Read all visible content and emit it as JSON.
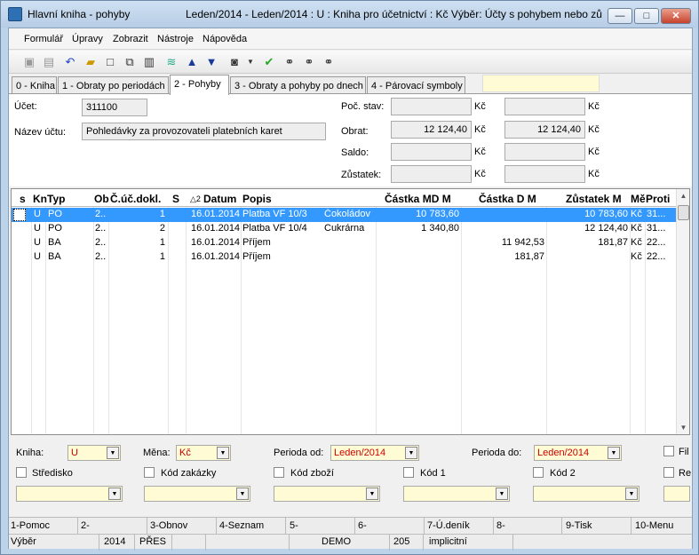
{
  "window": {
    "title_left": "Hlavní kniha - pohyby",
    "title_right": "Leden/2014 - Leden/2014 : U : Kniha pro účetnictví : Kč Výběr: Účty s pohybem nebo zů...",
    "min": "—",
    "max": "□",
    "close": "✕"
  },
  "menu": [
    "Formulář",
    "Úpravy",
    "Zobrazit",
    "Nástroje",
    "Nápověda"
  ],
  "tabs": [
    "0 - Kniha",
    "1 - Obraty po periodách",
    "2 - Pohyby",
    "3 - Obraty a pohyby po dnech",
    "4 - Párovací symboly"
  ],
  "header": {
    "ucet_label": "Účet:",
    "ucet_value": "311100",
    "nazev_label": "Název účtu:",
    "nazev_value": "Pohledávky za provozovateli platebních karet",
    "poc_stav_label": "Poč. stav:",
    "obrat_label": "Obrat:",
    "saldo_label": "Saldo:",
    "zustatek_label": "Zůstatek:",
    "obrat_value1": "12 124,40",
    "obrat_value2": "12 124,40",
    "currency": "Kč"
  },
  "grid": {
    "columns": [
      "s",
      "Kn",
      "Typ",
      "Ob",
      "Č.úč.dokl.",
      "S",
      "Datum",
      "Popis",
      "Částka MD M",
      "Částka D M",
      "Zůstatek M",
      "Mě",
      "Proti"
    ],
    "sort_marker": "△2",
    "rows": [
      [
        "",
        "U",
        "PO",
        "2..",
        "1",
        "",
        "16.01.2014",
        "Platba VF 10/3",
        "Čokoládov",
        "10 783,60",
        "",
        "10 783,60",
        "Kč",
        "31..."
      ],
      [
        "",
        "U",
        "PO",
        "2..",
        "2",
        "",
        "16.01.2014",
        "Platba VF 10/4",
        "Cukrárna",
        "1 340,80",
        "",
        "12 124,40",
        "Kč",
        "31..."
      ],
      [
        "",
        "U",
        "BA",
        "2..",
        "1",
        "",
        "16.01.2014",
        "Příjem",
        "",
        "",
        "11 942,53",
        "181,87",
        "Kč",
        "22..."
      ],
      [
        "",
        "U",
        "BA",
        "2..",
        "1",
        "",
        "16.01.2014",
        "Příjem",
        "",
        "",
        "181,87",
        "",
        "Kč",
        "22..."
      ]
    ]
  },
  "filters": {
    "kniha_label": "Kniha:",
    "kniha_value": "U",
    "mena_label": "Měna:",
    "mena_value": "Kč",
    "perioda_od_label": "Perioda od:",
    "perioda_od_value": "Leden/2014",
    "perioda_do_label": "Perioda do:",
    "perioda_do_value": "Leden/2014",
    "fil_label": "Fil",
    "re_label": "Re",
    "stredisko_label": "Středisko",
    "kod_zakazky_label": "Kód zakázky",
    "kod_zbozi_label": "Kód zboží",
    "kod1_label": "Kód 1",
    "kod2_label": "Kód 2"
  },
  "fnkeys": [
    "1-Pomoc",
    "2-",
    "3-Obnov",
    "4-Seznam",
    "5-",
    "6-",
    "7-Ú.deník",
    "8-",
    "9-Tisk",
    "10-Menu"
  ],
  "status": [
    "Výběr",
    "2014",
    "PŘES",
    "DEMO",
    "205",
    "implicitní"
  ]
}
